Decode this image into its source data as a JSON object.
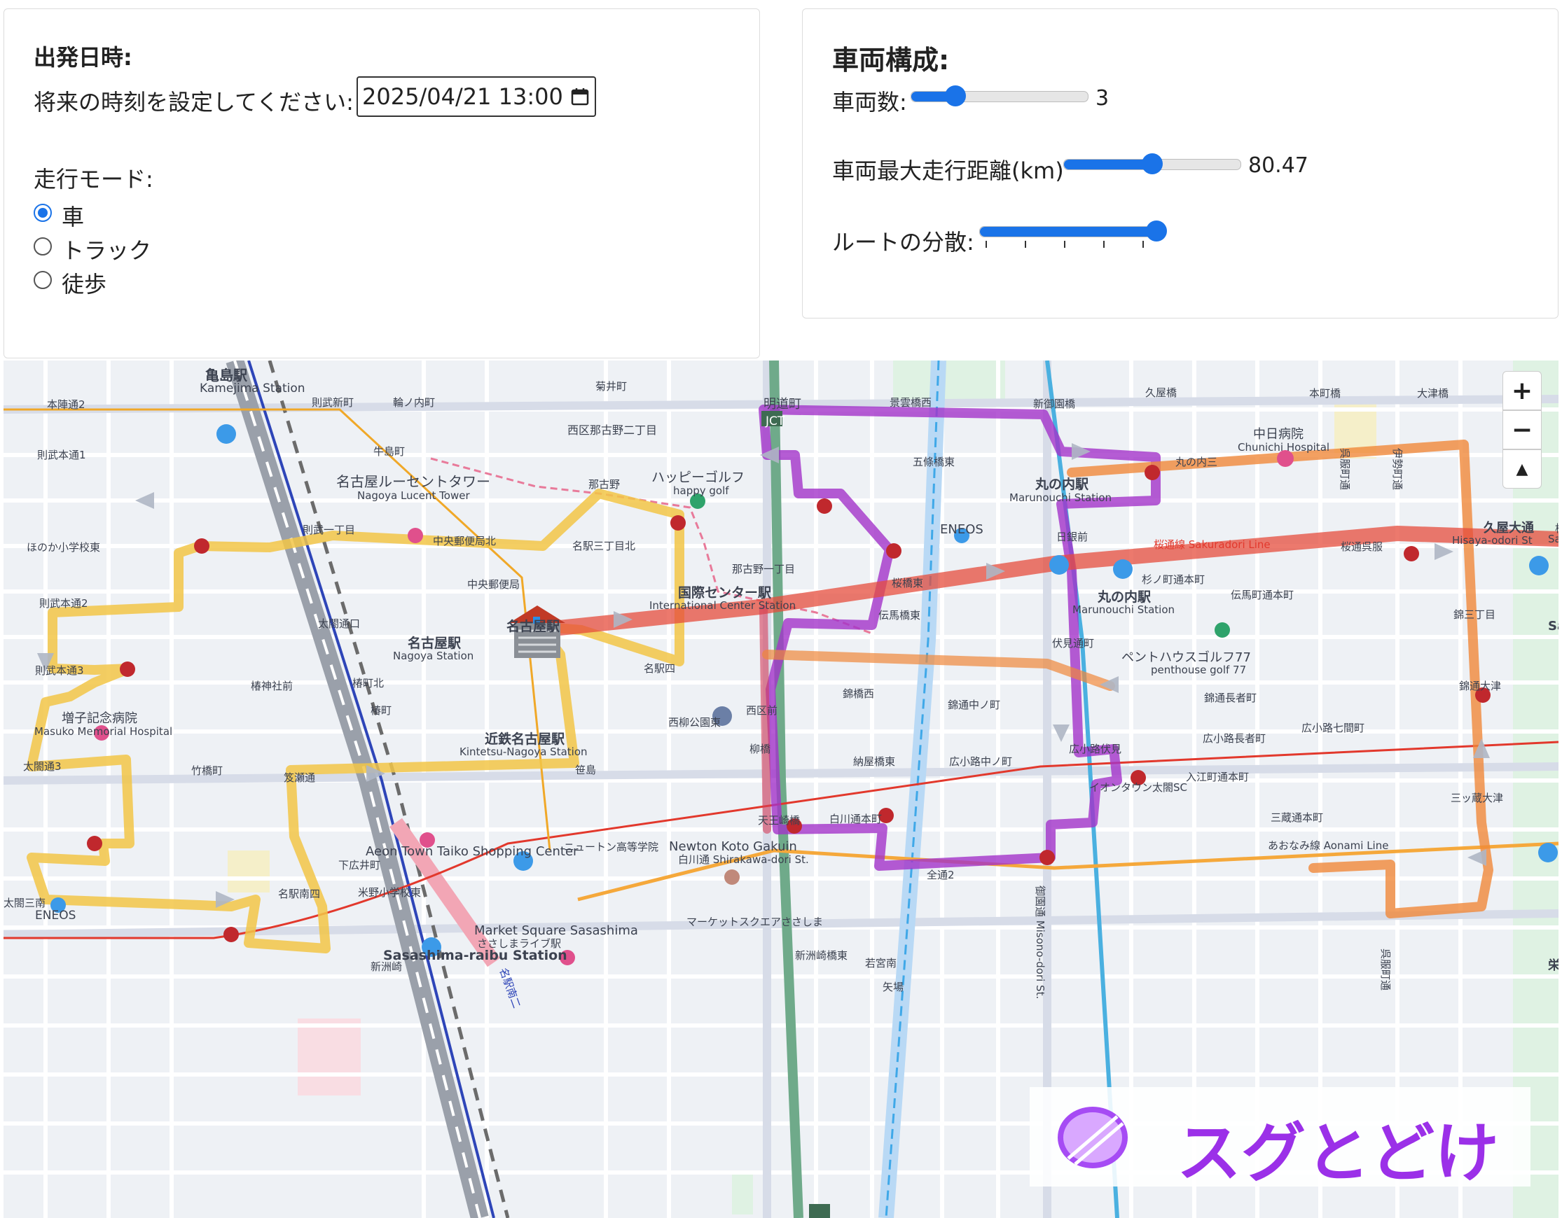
{
  "departure": {
    "heading": "出発日時:",
    "prompt": "将来の時刻を設定してください:",
    "datetime_value": "2025/04/21 13:00"
  },
  "travel_mode": {
    "heading": "走行モード:",
    "options": [
      {
        "label": "車",
        "selected": true
      },
      {
        "label": "トラック",
        "selected": false
      },
      {
        "label": "徒歩",
        "selected": false
      }
    ]
  },
  "vehicles": {
    "heading": "車両構成:",
    "count_label": "車両数:",
    "count_value": "3",
    "count_fraction": 0.25,
    "max_distance_label": "車両最大走行距離(km)",
    "max_distance_value": "80.47",
    "max_distance_fraction": 0.5,
    "route_spread_label": "ルートの分散:",
    "route_spread_fraction": 1.0
  },
  "map_controls": {
    "zoom_in": "+",
    "zoom_out": "−",
    "compass": "▲"
  },
  "brand": {
    "name": "スグとどけ",
    "logo_color": "#a64bf4"
  },
  "route_colors": {
    "yellow": "#f2c546",
    "purple": "#a233c9",
    "orange": "#f0883a",
    "red": "#e64c3c",
    "stop": "#c0282d"
  },
  "map_labels": [
    "亀島駅",
    "Kamejima Station",
    "本陣通2",
    "則武新町",
    "輪ノ内町",
    "菊井町",
    "牛島町",
    "則武本通1",
    "名古屋ルーセントタワー",
    "Nagoya Lucent Tower",
    "西区那古野二丁目",
    "那古野",
    "ハッピーゴルフ",
    "happy golf",
    "明道町",
    "JCT",
    "景雲橋西",
    "新御園橋",
    "五條橋東",
    "丸の内駅",
    "Marunouchi Station",
    "中日病院",
    "Chunichi Hospital",
    "呉服町通",
    "伊勢町通",
    "大津橋",
    "久屋橋",
    "本町橋",
    "丸の内三",
    "ENEOS",
    "那古野一丁目",
    "則武一丁目",
    "中央郵便局北",
    "名駅三丁目北",
    "ほのか小学校東",
    "杉ノ町通本町",
    "久屋大通",
    "Hisaya-odori St",
    "桜通呉服",
    "日銀前",
    "桜通線 Sakuradori Line",
    "中央郵便局",
    "国際センター駅",
    "International Center Station",
    "桜橋東",
    "則武本通2",
    "太閤通口",
    "名古屋駅",
    "Nagoya Station",
    "伝馬町通本町",
    "丸の内駅",
    "錦三丁目",
    "伝馬橋東",
    "伏見通町",
    "ペントハウスゴルフ77",
    "penthouse golf 77",
    "名駅四",
    "則武本通3",
    "椿神社前",
    "椿町北",
    "錦通大津",
    "錦橋西",
    "錦通中ノ町",
    "錦通長者町",
    "増子記念病院",
    "Masuko Memorial Hospital",
    "椿町",
    "西柳公園東",
    "西区前",
    "広小路長者町",
    "広小路七間町",
    "近鉄名古屋駅",
    "Kintetsu-Nagoya Station",
    "太閤通3",
    "竹橋町",
    "笈瀬通",
    "笹島",
    "柳橋",
    "納屋橋東",
    "広小路中ノ町",
    "広小路伏見",
    "入江町通本町",
    "三ッ蔵大津",
    "三蔵通本町",
    "御園通 Misono-dori St.",
    "あおなみ線 Aonami Line",
    "名駅南二",
    "天王崎橋",
    "白川通本町",
    "三蔵",
    "イオンタウン太閤SC",
    "Aeon Town Taiko Shopping Center",
    "下広井町",
    "ニュートン高等学院",
    "Newton Koto Gakuin",
    "白川通 Shirakawa-dori St.",
    "全通2",
    "太閤三南",
    "米野小学校東",
    "名駅南四",
    "マーケットスクエアささしま",
    "Market Square Sasashima",
    "ささしまライブ駅",
    "Sasashima-raibu Station",
    "新洲崎",
    "新洲崎橋東",
    "若宮南",
    "矢場",
    "栄駅",
    "Sakae Station",
    "桜通",
    "Sakura"
  ]
}
